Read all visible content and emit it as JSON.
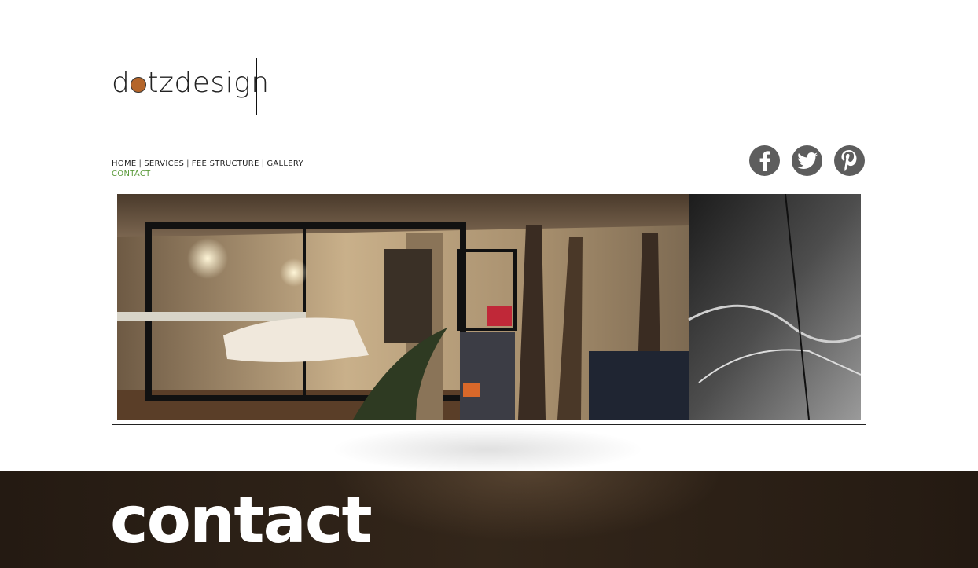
{
  "brand": {
    "logo_prefix": "d",
    "logo_suffix": "tzdesign",
    "accent_color": "#b4652a"
  },
  "nav": {
    "items": [
      "HOME",
      "SERVICES",
      "FEE STRUCTURE",
      "GALLERY"
    ],
    "separator": "|",
    "contact": "CONTACT",
    "contact_color": "#5a9a3a"
  },
  "social": [
    {
      "icon": "facebook-icon"
    },
    {
      "icon": "twitter-icon"
    },
    {
      "icon": "pinterest-icon"
    }
  ],
  "footer": {
    "title": "contact"
  }
}
